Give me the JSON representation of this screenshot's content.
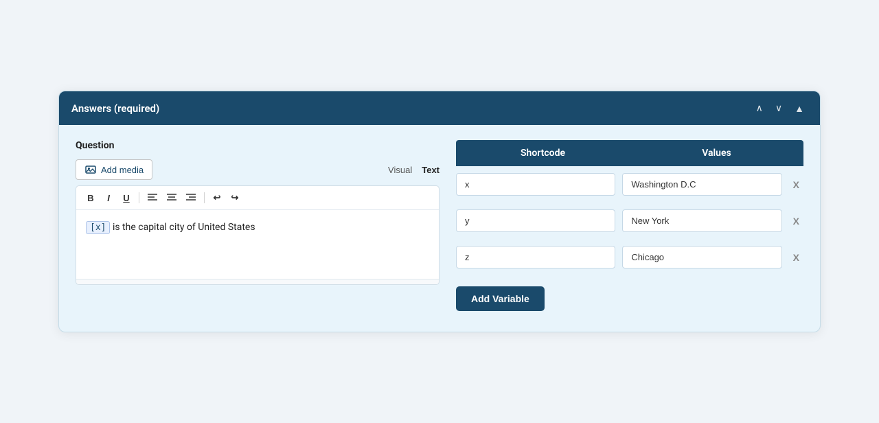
{
  "header": {
    "title": "Answers (required)",
    "controls": {
      "up_label": "∧",
      "down_label": "∨",
      "collapse_label": "▲"
    }
  },
  "question": {
    "label": "Question",
    "add_media_label": "Add media",
    "view_tabs": [
      {
        "id": "visual",
        "label": "Visual"
      },
      {
        "id": "text",
        "label": "Text"
      }
    ],
    "active_tab": "text",
    "editor_content_prefix": "[x]",
    "editor_content_text": " is the capital city of United States",
    "format_buttons": [
      {
        "id": "bold",
        "label": "B"
      },
      {
        "id": "italic",
        "label": "I"
      },
      {
        "id": "underline",
        "label": "U"
      },
      {
        "id": "align-left",
        "label": "≡"
      },
      {
        "id": "align-center",
        "label": "≡"
      },
      {
        "id": "align-right",
        "label": "≡"
      },
      {
        "id": "undo",
        "label": "↩"
      },
      {
        "id": "redo",
        "label": "↪"
      }
    ]
  },
  "variables_table": {
    "col_shortcode": "Shortcode",
    "col_values": "Values",
    "rows": [
      {
        "id": "row1",
        "shortcode": "x",
        "value": "Washington D.C"
      },
      {
        "id": "row2",
        "shortcode": "y",
        "value": "New York"
      },
      {
        "id": "row3",
        "shortcode": "z",
        "value": "Chicago"
      }
    ],
    "remove_label": "X",
    "add_variable_label": "Add Variable"
  }
}
